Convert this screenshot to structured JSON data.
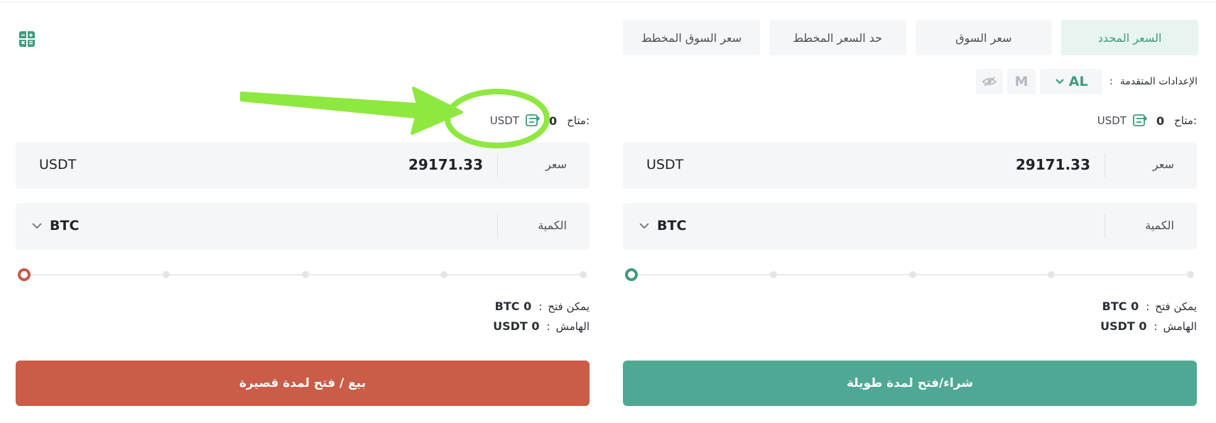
{
  "tabs": [
    "السعر المحدد",
    "سعر السوق",
    "حد السعر المخطط",
    "سعر السوق المخطط"
  ],
  "advanced": {
    "label": "الإعدادات المتقدمة",
    "colon": ":",
    "al_label": "AL",
    "m_label": "M"
  },
  "buy": {
    "available_label": "متاح:",
    "available_value": "0",
    "available_unit": "USDT",
    "price_label": "سعر",
    "price_value": "29171.33",
    "price_unit": "USDT",
    "qty_label": "الكمية",
    "qty_unit": "BTC",
    "slider_fraction": 0,
    "open_label": "يمكن فتح",
    "open_value": "BTC 0",
    "margin_label": "الهامش",
    "margin_value": "USDT 0",
    "action_label": "شراء/فتح لمدة طويلة",
    "accent": "#4fa894"
  },
  "sell": {
    "available_label": "متاح:",
    "available_value": "0",
    "available_unit": "USDT",
    "price_label": "سعر",
    "price_value": "29171.33",
    "price_unit": "USDT",
    "qty_label": "الكمية",
    "qty_unit": "BTC",
    "slider_fraction": 0,
    "open_label": "يمكن فتح",
    "open_value": "BTC 0",
    "margin_label": "الهامش",
    "margin_value": "USDT 0",
    "action_label": "بيع / فتح لمدة قصيرة",
    "accent": "#cb5c47"
  },
  "colon": ":",
  "annotation_color": "#8ee840",
  "icons": [
    "calculator-icon",
    "transfer-icon",
    "chevron-down-icon",
    "eye-off-icon"
  ]
}
